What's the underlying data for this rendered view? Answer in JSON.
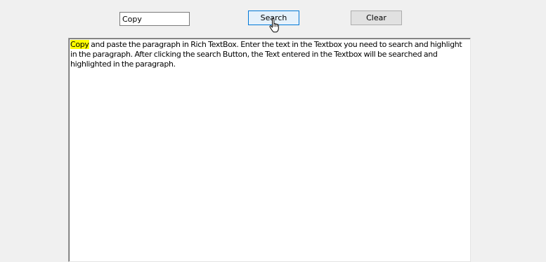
{
  "search": {
    "value": "Copy"
  },
  "buttons": {
    "search_label": "Search",
    "clear_label": "Clear"
  },
  "rich_textbox": {
    "highlighted_text": "Copy",
    "rest_text": " and paste the paragraph in Rich TextBox. Enter the text in the Textbox you need to search and highlight in the paragraph. After clicking the search Button, the Text entered in the Textbox will be searched and highlighted in the paragraph.",
    "highlight_color": "#ffff00"
  },
  "cursor": {
    "icon": "pointer-hand-icon"
  }
}
